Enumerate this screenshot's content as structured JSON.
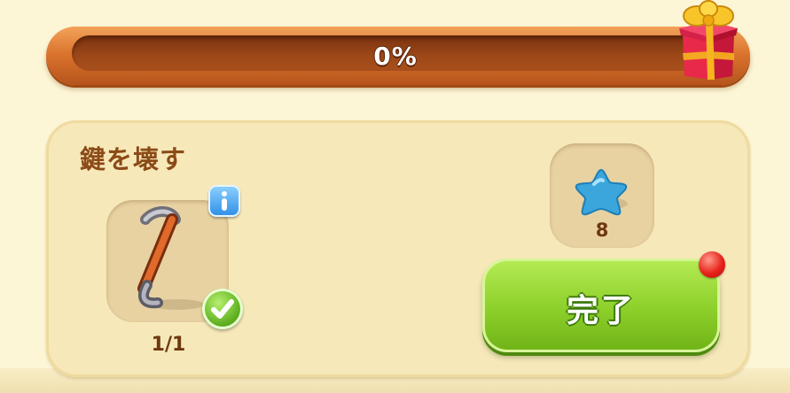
{
  "progress": {
    "percent": 0,
    "label": "0%",
    "reward_icon": "gift-box-icon"
  },
  "quest": {
    "title": "鍵を壊す",
    "item": {
      "icon": "crowbar-icon",
      "count": "1/1",
      "info_icon": "info-icon",
      "status_icon": "checkmark-icon",
      "completed": true
    },
    "reward": {
      "icon": "blue-star-icon",
      "count": "8"
    },
    "complete_button": {
      "label": "完了",
      "has_notification": true
    }
  },
  "colors": {
    "background": "#fdf6d6",
    "progress_bar_outer": "#d8712b",
    "progress_track": "#9e4818",
    "panel": "#f6e8b9",
    "title_text": "#8b4a16",
    "button_green": "#8ccf2a",
    "notification_red": "#e8231b",
    "star_blue": "#3aa6dc"
  }
}
